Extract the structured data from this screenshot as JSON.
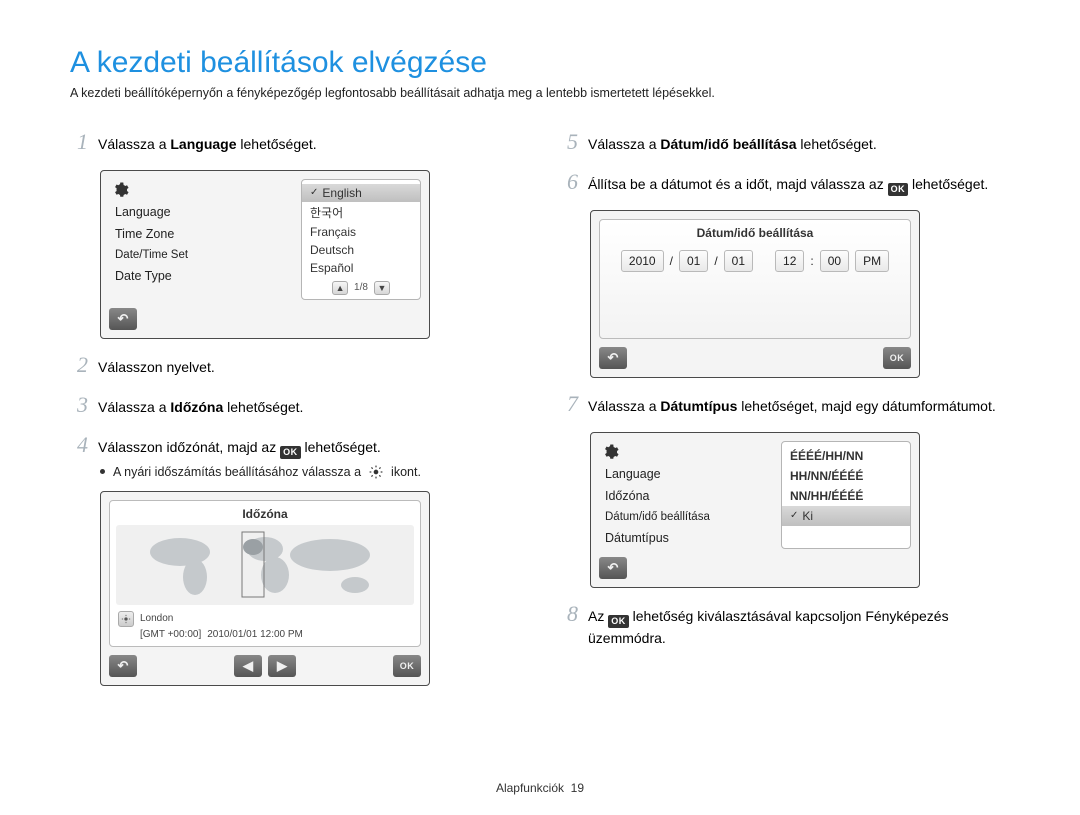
{
  "page": {
    "title": "A kezdeti beállítások elvégzése",
    "intro": "A kezdeti beállítóképernyőn a fényképezőgép legfontosabb beállításait adhatja meg a lentebb ismertetett lépésekkel.",
    "footer_section": "Alapfunkciók",
    "footer_page": "19"
  },
  "steps": {
    "s1": {
      "num": "1",
      "pre": "Válassza a ",
      "bold": "Language",
      "post": " lehetőséget."
    },
    "s2": {
      "num": "2",
      "text": "Válasszon nyelvet."
    },
    "s3": {
      "num": "3",
      "pre": "Válassza a ",
      "bold": "Időzóna",
      "post": " lehetőséget."
    },
    "s4": {
      "num": "4",
      "pre": "Válasszon időzónát, majd az ",
      "post": " lehetőséget."
    },
    "s4_bullet": "A nyári időszámítás beállításához válassza a",
    "s4_bullet_post": "ikont.",
    "s5": {
      "num": "5",
      "pre": "Válassza a ",
      "bold": "Dátum/idő beállítása",
      "post": " lehetőséget."
    },
    "s6": {
      "num": "6",
      "pre": "Állítsa be a dátumot és a időt, majd válassza az ",
      "post": "lehetőséget."
    },
    "s7": {
      "num": "7",
      "pre": "Válassza a ",
      "bold": "Dátumtípus",
      "post": " lehetőséget, majd egy dátumformátumot."
    },
    "s8": {
      "num": "8",
      "pre": "Az ",
      "post": " lehetőség kiválasztásával kapcsoljon Fényképezés üzemmódra."
    }
  },
  "ok_label": "OK",
  "screen1": {
    "left": [
      "Language",
      "Time Zone",
      "Date/Time Set",
      "Date Type"
    ],
    "options": [
      "English",
      "한국어",
      "Français",
      "Deutsch",
      "Español"
    ],
    "pager": "1/8"
  },
  "screen_tz": {
    "title": "Időzóna",
    "city": "London",
    "gmt": "[GMT +00:00]",
    "datetime": "2010/01/01 12:00 PM"
  },
  "screen_dt": {
    "title": "Dátum/idő beállítása",
    "year": "2010",
    "month": "01",
    "day": "01",
    "hour": "12",
    "min": "00",
    "ampm": "PM",
    "sep_date": "/",
    "sep_time": ":"
  },
  "screen_type": {
    "left": [
      "Language",
      "Időzóna",
      "Dátum/idő beállítása",
      "Dátumtípus"
    ],
    "options": [
      "ÉÉÉÉ/HH/NN",
      "HH/NN/ÉÉÉÉ",
      "NN/HH/ÉÉÉÉ",
      "Ki"
    ]
  }
}
